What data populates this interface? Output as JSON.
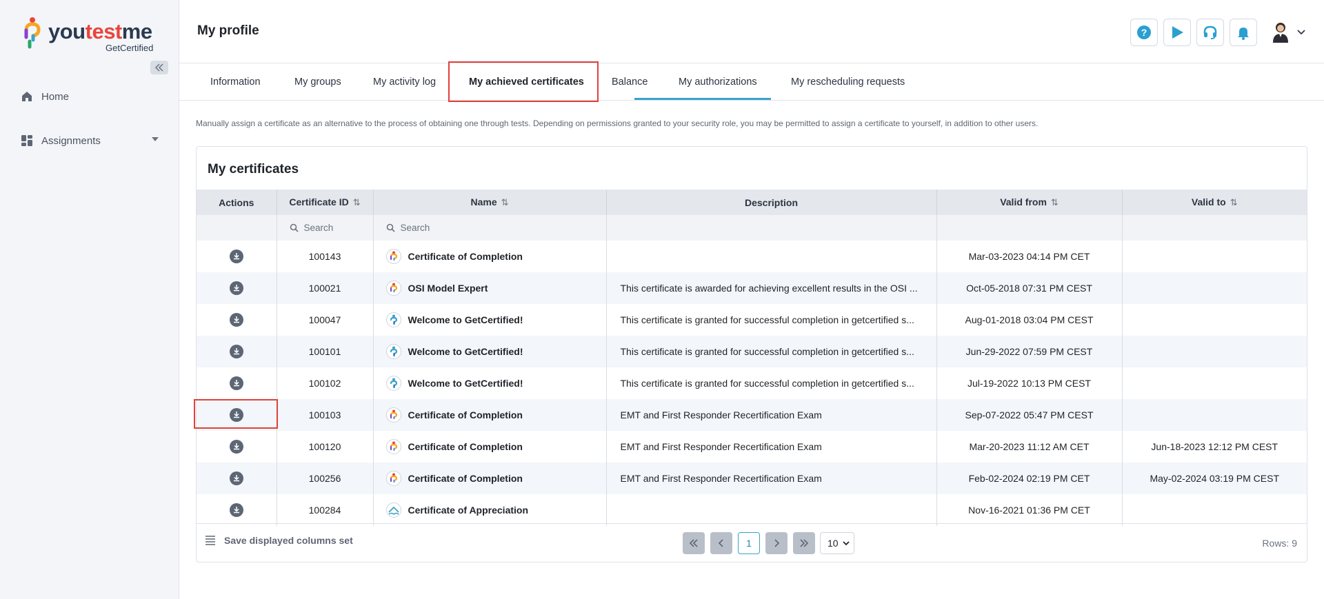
{
  "app": {
    "logo_text_a": "you",
    "logo_text_b": "test",
    "logo_text_c": "me",
    "logo_sub": "GetCertified"
  },
  "sidebar": {
    "items": [
      {
        "label": "Home",
        "icon": "home-icon"
      },
      {
        "label": "Assignments",
        "icon": "dashboard-icon"
      }
    ]
  },
  "header": {
    "title": "My profile",
    "buttons": [
      {
        "icon": "help-icon"
      },
      {
        "icon": "play-icon"
      },
      {
        "icon": "headset-icon"
      },
      {
        "icon": "bell-icon"
      }
    ]
  },
  "tabs": [
    {
      "label": "Information"
    },
    {
      "label": "My groups"
    },
    {
      "label": "My activity log"
    },
    {
      "label": "My achieved certificates",
      "active": true
    },
    {
      "label": "Balance"
    },
    {
      "label": "My authorizations"
    },
    {
      "label": "My rescheduling requests"
    }
  ],
  "intro": "Manually assign a certificate as an alternative to the process of obtaining one through tests. Depending on permissions granted to your security role, you may be permitted to assign a certificate to yourself, in addition to other users.",
  "card": {
    "title": "My certificates",
    "columns": [
      "Actions",
      "Certificate ID",
      "Name",
      "Description",
      "Valid from",
      "Valid to"
    ],
    "search_placeholder": "Search",
    "rows": [
      {
        "id": "100143",
        "name": "Certificate of Completion",
        "description": "",
        "valid_from": "Mar-03-2023 04:14 PM CET",
        "valid_to": "",
        "icon": "person-badge-icon"
      },
      {
        "id": "100021",
        "name": "OSI Model Expert",
        "description": "This certificate is awarded for achieving excellent results in the OSI ...",
        "valid_from": "Oct-05-2018 07:31 PM CEST",
        "valid_to": "",
        "icon": "person-badge-icon"
      },
      {
        "id": "100047",
        "name": "Welcome to GetCertified!",
        "description": "This certificate is granted for successful completion in getcertified s...",
        "valid_from": "Aug-01-2018 03:04 PM CEST",
        "valid_to": "",
        "icon": "person-badge-blue-icon"
      },
      {
        "id": "100101",
        "name": "Welcome to GetCertified!",
        "description": "This certificate is granted for successful completion in getcertified s...",
        "valid_from": "Jun-29-2022 07:59 PM CEST",
        "valid_to": "",
        "icon": "person-badge-blue-icon"
      },
      {
        "id": "100102",
        "name": "Welcome to GetCertified!",
        "description": "This certificate is granted for successful completion in getcertified s...",
        "valid_from": "Jul-19-2022 10:13 PM CEST",
        "valid_to": "",
        "icon": "person-badge-blue-icon"
      },
      {
        "id": "100103",
        "name": "Certificate of Completion",
        "description": "EMT and First Responder Recertification Exam",
        "valid_from": "Sep-07-2022 05:47 PM CEST",
        "valid_to": "",
        "icon": "person-badge-icon"
      },
      {
        "id": "100120",
        "name": "Certificate of Completion",
        "description": "EMT and First Responder Recertification Exam",
        "valid_from": "Mar-20-2023 11:12 AM CET",
        "valid_to": "Jun-18-2023 12:12 PM CEST",
        "icon": "person-badge-icon"
      },
      {
        "id": "100256",
        "name": "Certificate of Completion",
        "description": "EMT and First Responder Recertification Exam",
        "valid_from": "Feb-02-2024 02:19 PM CET",
        "valid_to": "May-02-2024 03:19 PM CEST",
        "icon": "person-badge-icon"
      },
      {
        "id": "100284",
        "name": "Certificate of Appreciation",
        "description": "",
        "valid_from": "Nov-16-2021 01:36 PM CET",
        "valid_to": "",
        "icon": "wave-badge-icon"
      }
    ],
    "footer": {
      "save_columns_label": "Save displayed columns set",
      "current_page": "1",
      "page_size": "10",
      "rows_label": "Rows: 9"
    }
  },
  "colors": {
    "accent": "#3aa3c9",
    "highlight": "#e0403a",
    "brand_dark": "#2b3a4e"
  }
}
